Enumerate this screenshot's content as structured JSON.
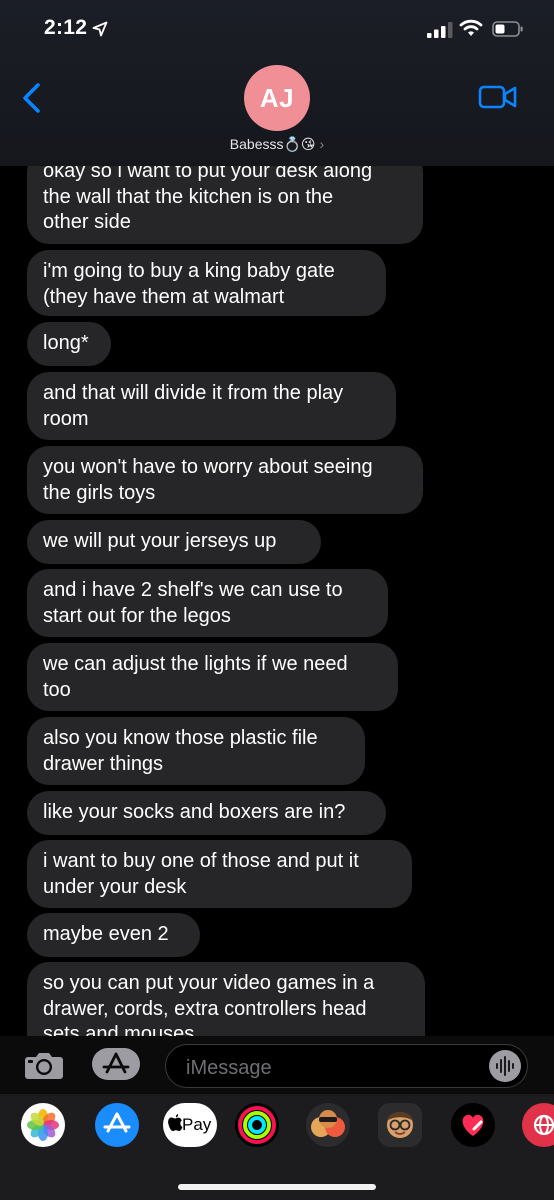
{
  "status_bar": {
    "time": "2:12"
  },
  "header": {
    "avatar_initials": "AJ",
    "contact_name": "Babesss💍😘",
    "contact_chevron": "›"
  },
  "messages": [
    {
      "text": "okay so i want to put your desk along\nthe wall that the kitchen is on the\nother side"
    },
    {
      "text": "i'm going to buy a king baby gate\n(they have them at walmart"
    },
    {
      "text": "long*"
    },
    {
      "text": "and that will divide it from the play\nroom"
    },
    {
      "text": "you won't have to worry about seeing\nthe girls toys"
    },
    {
      "text": "we will put your jerseys up"
    },
    {
      "text": "and i have 2 shelf's we can use to\nstart out for the legos"
    },
    {
      "text": "we can adjust the lights if we need\ntoo"
    },
    {
      "text": "also you know those plastic file\ndrawer things"
    },
    {
      "text": "like your socks and boxers are in?"
    },
    {
      "text": "i want to buy one of those and put it\nunder your desk"
    },
    {
      "text": "maybe even 2"
    },
    {
      "text": "so you can put your video games in a\ndrawer, cords, extra controllers head\nsets and mouses"
    }
  ],
  "input": {
    "placeholder": "iMessage"
  },
  "app_drawer": {
    "apps": [
      "photos-icon",
      "app-store-icon",
      "apple-pay-icon",
      "activity-icon",
      "memoji-stickers-icon",
      "memoji-icon",
      "digital-touch-icon",
      "search-web-icon"
    ],
    "apple_pay_label": "Pay"
  },
  "colors": {
    "accent": "#0a84ff",
    "bubble": "#262628",
    "avatar": "#f08f95",
    "header_bg": "#1b1e26"
  }
}
